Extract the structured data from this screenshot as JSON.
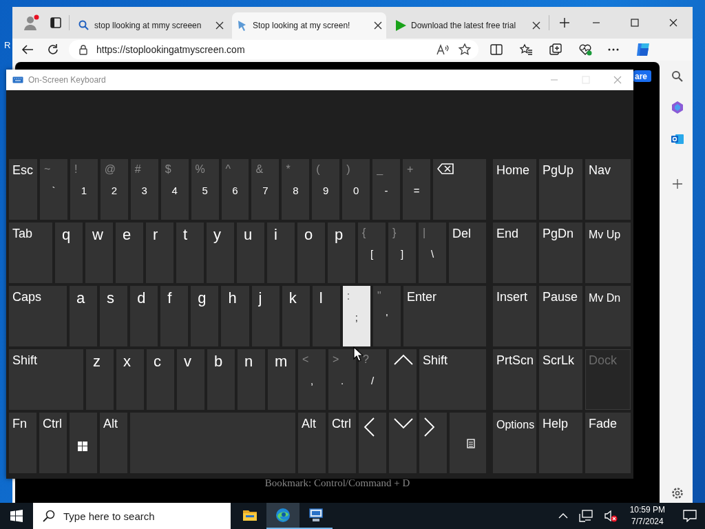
{
  "desktop": {
    "icon_label": "R"
  },
  "browser": {
    "tabs": [
      {
        "title": "stop llooking at mmy screeen",
        "selected": false,
        "kind": "search"
      },
      {
        "title": "Stop looking at my screen!",
        "selected": true,
        "kind": "site"
      },
      {
        "title": "Download the latest free trial",
        "selected": false,
        "kind": "download"
      }
    ],
    "address": {
      "value": "https://stoplookingatmyscreen.com"
    },
    "page": {
      "button": "are",
      "footer": "Bookmark: Control/Command + D"
    }
  },
  "osk": {
    "title": "On-Screen Keyboard",
    "main_rows": [
      [
        {
          "kind": "fn",
          "main": "Esc",
          "highlighted": false,
          "disabled": false
        },
        {
          "kind": "symbol",
          "shift": "~",
          "main": "`",
          "highlighted": false,
          "disabled": false
        },
        {
          "kind": "symbol",
          "shift": "!",
          "main": "1",
          "highlighted": false,
          "disabled": false
        },
        {
          "kind": "symbol",
          "shift": "@",
          "main": "2",
          "highlighted": false,
          "disabled": false
        },
        {
          "kind": "symbol",
          "shift": "#",
          "main": "3",
          "highlighted": false,
          "disabled": false
        },
        {
          "kind": "symbol",
          "shift": "$",
          "main": "4",
          "highlighted": false,
          "disabled": false
        },
        {
          "kind": "symbol",
          "shift": "%",
          "main": "5",
          "highlighted": false,
          "disabled": false
        },
        {
          "kind": "symbol",
          "shift": "^",
          "main": "6",
          "highlighted": false,
          "disabled": false
        },
        {
          "kind": "symbol",
          "shift": "&",
          "main": "7",
          "highlighted": false,
          "disabled": false
        },
        {
          "kind": "symbol",
          "shift": "*",
          "main": "8",
          "highlighted": false,
          "disabled": false
        },
        {
          "kind": "symbol",
          "shift": "(",
          "main": "9",
          "highlighted": false,
          "disabled": false
        },
        {
          "kind": "symbol",
          "shift": ")",
          "main": "0",
          "highlighted": false,
          "disabled": false
        },
        {
          "kind": "symbol",
          "shift": "_",
          "main": "-",
          "highlighted": false,
          "disabled": false
        },
        {
          "kind": "symbol",
          "shift": "+",
          "main": "=",
          "highlighted": false,
          "disabled": false
        },
        {
          "kind": "backspace",
          "highlighted": false,
          "disabled": false
        }
      ],
      [
        {
          "kind": "fn",
          "main": "Tab",
          "highlighted": false,
          "disabled": false
        },
        {
          "kind": "letter",
          "main": "q",
          "highlighted": false,
          "disabled": false
        },
        {
          "kind": "letter",
          "main": "w",
          "highlighted": false,
          "disabled": false
        },
        {
          "kind": "letter",
          "main": "e",
          "highlighted": false,
          "disabled": false
        },
        {
          "kind": "letter",
          "main": "r",
          "highlighted": false,
          "disabled": false
        },
        {
          "kind": "letter",
          "main": "t",
          "highlighted": false,
          "disabled": false
        },
        {
          "kind": "letter",
          "main": "y",
          "highlighted": false,
          "disabled": false
        },
        {
          "kind": "letter",
          "main": "u",
          "highlighted": false,
          "disabled": false
        },
        {
          "kind": "letter",
          "main": "i",
          "highlighted": false,
          "disabled": false
        },
        {
          "kind": "letter",
          "main": "o",
          "highlighted": false,
          "disabled": false
        },
        {
          "kind": "letter",
          "main": "p",
          "highlighted": false,
          "disabled": false
        },
        {
          "kind": "symbol",
          "shift": "{",
          "main": "[",
          "highlighted": false,
          "disabled": false
        },
        {
          "kind": "symbol",
          "shift": "}",
          "main": "]",
          "highlighted": false,
          "disabled": false
        },
        {
          "kind": "symbol",
          "shift": "|",
          "main": "\\",
          "highlighted": false,
          "disabled": false
        },
        {
          "kind": "fn",
          "main": "Del",
          "highlighted": false,
          "disabled": false
        }
      ],
      [
        {
          "kind": "fn",
          "main": "Caps",
          "highlighted": false,
          "disabled": false
        },
        {
          "kind": "letter",
          "main": "a",
          "highlighted": false,
          "disabled": false
        },
        {
          "kind": "letter",
          "main": "s",
          "highlighted": false,
          "disabled": false
        },
        {
          "kind": "letter",
          "main": "d",
          "highlighted": false,
          "disabled": false
        },
        {
          "kind": "letter",
          "main": "f",
          "highlighted": false,
          "disabled": false
        },
        {
          "kind": "letter",
          "main": "g",
          "highlighted": false,
          "disabled": false
        },
        {
          "kind": "letter",
          "main": "h",
          "highlighted": false,
          "disabled": false
        },
        {
          "kind": "letter",
          "main": "j",
          "highlighted": false,
          "disabled": false
        },
        {
          "kind": "letter",
          "main": "k",
          "highlighted": false,
          "disabled": false
        },
        {
          "kind": "letter",
          "main": "l",
          "highlighted": false,
          "disabled": false
        },
        {
          "kind": "symbol",
          "shift": ":",
          "main": ";",
          "highlighted": true,
          "disabled": false
        },
        {
          "kind": "symbol",
          "shift": "\"",
          "main": "'",
          "highlighted": false,
          "disabled": false
        },
        {
          "kind": "fn",
          "main": "Enter",
          "highlighted": false,
          "disabled": false
        }
      ],
      [
        {
          "kind": "fn",
          "main": "Shift",
          "highlighted": false,
          "disabled": false
        },
        {
          "kind": "letter",
          "main": "z",
          "highlighted": false,
          "disabled": false
        },
        {
          "kind": "letter",
          "main": "x",
          "highlighted": false,
          "disabled": false
        },
        {
          "kind": "letter",
          "main": "c",
          "highlighted": false,
          "disabled": false
        },
        {
          "kind": "letter",
          "main": "v",
          "highlighted": false,
          "disabled": false
        },
        {
          "kind": "letter",
          "main": "b",
          "highlighted": false,
          "disabled": false
        },
        {
          "kind": "letter",
          "main": "n",
          "highlighted": false,
          "disabled": false
        },
        {
          "kind": "letter",
          "main": "m",
          "highlighted": false,
          "disabled": false
        },
        {
          "kind": "symbol",
          "shift": "<",
          "main": ",",
          "highlighted": false,
          "disabled": false
        },
        {
          "kind": "symbol",
          "shift": ">",
          "main": ".",
          "highlighted": false,
          "disabled": false
        },
        {
          "kind": "symbol",
          "shift": "?",
          "main": "/",
          "highlighted": false,
          "disabled": false
        },
        {
          "kind": "arrow-up",
          "highlighted": false,
          "disabled": false
        },
        {
          "kind": "fn",
          "main": "Shift",
          "highlighted": false,
          "disabled": false
        }
      ],
      [
        {
          "kind": "fn",
          "main": "Fn",
          "highlighted": false,
          "disabled": false
        },
        {
          "kind": "fn",
          "main": "Ctrl",
          "highlighted": false,
          "disabled": false
        },
        {
          "kind": "windows",
          "highlighted": false,
          "disabled": false
        },
        {
          "kind": "fn",
          "main": "Alt",
          "highlighted": false,
          "disabled": false
        },
        {
          "kind": "space",
          "highlighted": false,
          "disabled": false
        },
        {
          "kind": "fn",
          "main": "Alt",
          "highlighted": false,
          "disabled": false
        },
        {
          "kind": "fn",
          "main": "Ctrl",
          "highlighted": false,
          "disabled": false
        },
        {
          "kind": "arrow-left",
          "highlighted": false,
          "disabled": false
        },
        {
          "kind": "arrow-down",
          "highlighted": false,
          "disabled": false
        },
        {
          "kind": "arrow-right",
          "highlighted": false,
          "disabled": false
        },
        {
          "kind": "menu",
          "highlighted": false,
          "disabled": false
        }
      ]
    ],
    "nav_rows": [
      [
        {
          "kind": "fn",
          "main": "Home",
          "highlighted": false,
          "disabled": false
        },
        {
          "kind": "fn",
          "main": "PgUp",
          "highlighted": false,
          "disabled": false
        },
        {
          "kind": "fn",
          "main": "Nav",
          "highlighted": false,
          "disabled": false
        }
      ],
      [
        {
          "kind": "fn",
          "main": "End",
          "highlighted": false,
          "disabled": false
        },
        {
          "kind": "fn",
          "main": "PgDn",
          "highlighted": false,
          "disabled": false
        },
        {
          "kind": "fn-small",
          "main": "Mv Up",
          "highlighted": false,
          "disabled": false
        }
      ],
      [
        {
          "kind": "fn",
          "main": "Insert",
          "highlighted": false,
          "disabled": false
        },
        {
          "kind": "fn",
          "main": "Pause",
          "highlighted": false,
          "disabled": false
        },
        {
          "kind": "fn-small",
          "main": "Mv Dn",
          "highlighted": false,
          "disabled": false
        }
      ],
      [
        {
          "kind": "fn",
          "main": "PrtScn",
          "highlighted": false,
          "disabled": false
        },
        {
          "kind": "fn",
          "main": "ScrLk",
          "highlighted": false,
          "disabled": false
        },
        {
          "kind": "fn",
          "main": "Dock",
          "highlighted": false,
          "disabled": true
        }
      ],
      [
        {
          "kind": "fn-small",
          "main": "Options",
          "highlighted": false,
          "disabled": false
        },
        {
          "kind": "fn",
          "main": "Help",
          "highlighted": false,
          "disabled": false
        },
        {
          "kind": "fn",
          "main": "Fade",
          "highlighted": false,
          "disabled": false
        }
      ]
    ]
  },
  "taskbar": {
    "search": {
      "placeholder": "Type here to search"
    },
    "apps": [
      {
        "kind": "folder",
        "selected": false
      },
      {
        "kind": "edge",
        "selected": true
      },
      {
        "kind": "network",
        "selected": false
      }
    ],
    "clock": {
      "time": "10:59 PM",
      "date": "7/7/2024"
    }
  }
}
